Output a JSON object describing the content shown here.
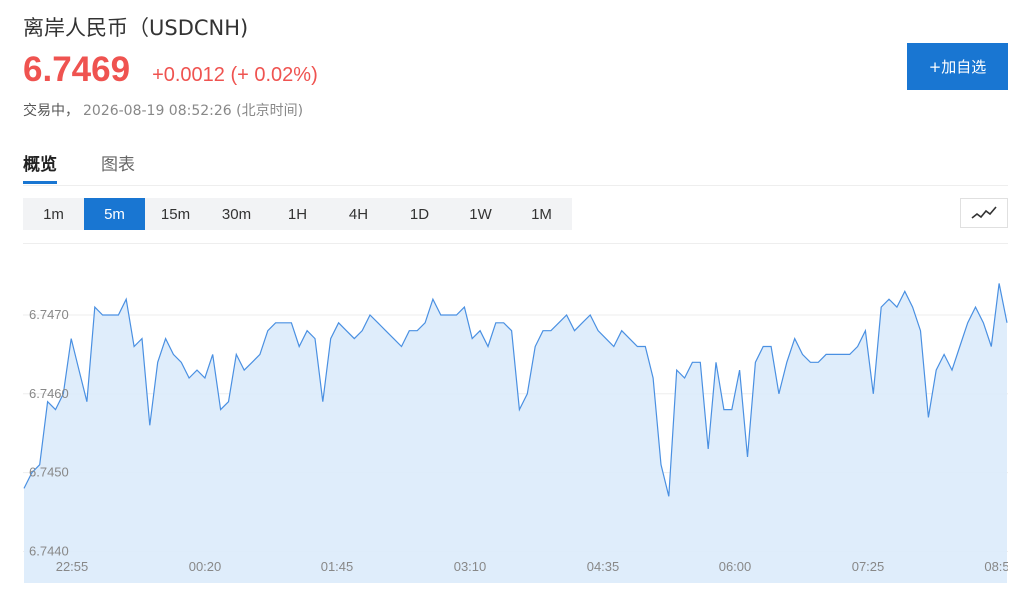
{
  "header": {
    "title": "离岸人民币（USDCNH)",
    "price": "6.7469",
    "change": "+0.0012 (+ 0.02%)",
    "status": "交易中，",
    "timestamp": "2026-08-19 08:52:26 (北京时间)"
  },
  "add_button_label": "+加自选",
  "tabs": [
    {
      "label": "概览",
      "active": true
    },
    {
      "label": "图表",
      "active": false
    }
  ],
  "intervals": [
    {
      "label": "1m",
      "active": false
    },
    {
      "label": "5m",
      "active": true
    },
    {
      "label": "15m",
      "active": false
    },
    {
      "label": "30m",
      "active": false
    },
    {
      "label": "1H",
      "active": false
    },
    {
      "label": "4H",
      "active": false
    },
    {
      "label": "1D",
      "active": false
    },
    {
      "label": "1W",
      "active": false
    },
    {
      "label": "1M",
      "active": false
    }
  ],
  "chart_type_icon": "line-chart-icon",
  "colors": {
    "accent": "#1976d2",
    "up": "#ef5350",
    "line": "#4a90e2",
    "fill": "#dcebfb"
  },
  "chart_data": {
    "type": "area",
    "ylim": [
      6.7436,
      6.7479
    ],
    "yticks": [
      "6.7440",
      "6.7450",
      "6.7460",
      "6.7470"
    ],
    "xticks": [
      "22:55",
      "00:20",
      "01:45",
      "03:10",
      "04:35",
      "06:00",
      "07:25",
      "08:5"
    ],
    "grid": true,
    "values": [
      6.7448,
      6.745,
      6.7451,
      6.7459,
      6.7458,
      6.746,
      6.7467,
      6.7463,
      6.7459,
      6.7471,
      6.747,
      6.747,
      6.747,
      6.7472,
      6.7466,
      6.7467,
      6.7456,
      6.7464,
      6.7467,
      6.7465,
      6.7464,
      6.7462,
      6.7463,
      6.7462,
      6.7465,
      6.7458,
      6.7459,
      6.7465,
      6.7463,
      6.7464,
      6.7465,
      6.7468,
      6.7469,
      6.7469,
      6.7469,
      6.7466,
      6.7468,
      6.7467,
      6.7459,
      6.7467,
      6.7469,
      6.7468,
      6.7467,
      6.7468,
      6.747,
      6.7469,
      6.7468,
      6.7467,
      6.7466,
      6.7468,
      6.7468,
      6.7469,
      6.7472,
      6.747,
      6.747,
      6.747,
      6.7471,
      6.7467,
      6.7468,
      6.7466,
      6.7469,
      6.7469,
      6.7468,
      6.7458,
      6.746,
      6.7466,
      6.7468,
      6.7468,
      6.7469,
      6.747,
      6.7468,
      6.7469,
      6.747,
      6.7468,
      6.7467,
      6.7466,
      6.7468,
      6.7467,
      6.7466,
      6.7466,
      6.7462,
      6.7451,
      6.7447,
      6.7463,
      6.7462,
      6.7464,
      6.7464,
      6.7453,
      6.7464,
      6.7458,
      6.7458,
      6.7463,
      6.7452,
      6.7464,
      6.7466,
      6.7466,
      6.746,
      6.7464,
      6.7467,
      6.7465,
      6.7464,
      6.7464,
      6.7465,
      6.7465,
      6.7465,
      6.7465,
      6.7466,
      6.7468,
      6.746,
      6.7471,
      6.7472,
      6.7471,
      6.7473,
      6.7471,
      6.7468,
      6.7457,
      6.7463,
      6.7465,
      6.7463,
      6.7466,
      6.7469,
      6.7471,
      6.7469,
      6.7466,
      6.7474,
      6.7469
    ]
  }
}
